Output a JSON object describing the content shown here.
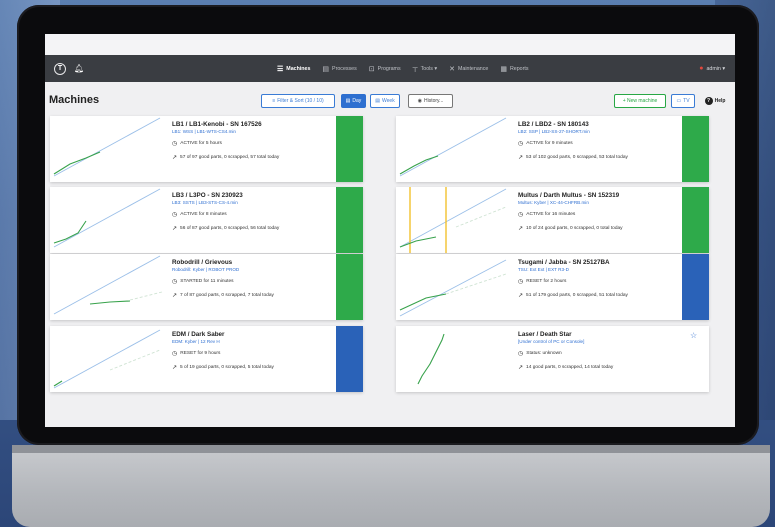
{
  "colors": {
    "green": "#2eaa4a",
    "blue": "#2a62b8",
    "accent": "#2f6fd1",
    "navbar": "#3a3d42"
  },
  "navbar": {
    "logo": "T",
    "items": [
      {
        "label": "Machines",
        "icon": "machines-icon",
        "glyph": "☰"
      },
      {
        "label": "Processes",
        "icon": "processes-icon",
        "glyph": "▤"
      },
      {
        "label": "Programs",
        "icon": "programs-icon",
        "glyph": "⊡"
      },
      {
        "label": "Tools ▾",
        "icon": "tools-icon",
        "glyph": "┬"
      },
      {
        "label": "Maintenance",
        "icon": "maintenance-icon",
        "glyph": "✕"
      },
      {
        "label": "Reports",
        "icon": "reports-icon",
        "glyph": "▦"
      }
    ],
    "user": "admin ▾"
  },
  "toolbar": {
    "title": "Machines",
    "filter": "Filter & Sort (10 / 10)",
    "day": "Day",
    "week": "Week",
    "history": "History...",
    "new_machine": "+ New machine",
    "tv": "TV",
    "help": "Help"
  },
  "machines": [
    {
      "title": "LB1 / LB1-Kenobi - SN 167526",
      "program": "LB1: WSS | LB1-WTS-CS4.min",
      "status": "ACTIVE for 5 hours",
      "parts": "57 of 97 good parts, 0 scrapped, 57 total today",
      "status_color": "green",
      "favorite": true
    },
    {
      "title": "LB2 / LBD2 - SN 180143",
      "program": "LB2: SSP | LB2-SS-27-SHORT.min",
      "status": "ACTIVE for 9 minutes",
      "parts": "53 of 102 good parts, 0 scrapped, 53 total today",
      "status_color": "green",
      "favorite": true
    },
    {
      "title": "LB3 / L3PO - SN 230923",
      "program": "LB3: SSTS | LB3-STS-CS-4.min",
      "status": "ACTIVE for 8 minutes",
      "parts": "56 of 87 good parts, 0 scrapped, 56 total today",
      "status_color": "green",
      "favorite": true
    },
    {
      "title": "Multus / Darth Multus - SN 152319",
      "program": "Multus: Kyber | XC-44-CHFRB.min",
      "status": "ACTIVE for 16 minutes",
      "parts": "10 of 24 good parts, 0 scrapped, 0 total today",
      "status_color": "green",
      "favorite": false
    },
    {
      "title": "Robodrill / Grievous",
      "program": "Robodrill: Kyber | ROBOT PROD",
      "status": "STARTED for 11 minutes",
      "parts": "7 of 87 good parts, 0 scrapped, 7 total today",
      "status_color": "green",
      "favorite": false
    },
    {
      "title": "Tsugami / Jabba - SN 25127BA",
      "program": "TSU: Ext Ext | EXT R3-D",
      "status": "RESET for 2 hours",
      "parts": "51 of 179 good parts, 0 scrapped, 51 total today",
      "status_color": "blue",
      "favorite": false
    },
    {
      "title": "EDM / Dark Saber",
      "program": "EDM: Kyber | 12 Rev H",
      "status": "RESET for 9 hours",
      "parts": "5 of 19 good parts, 0 scrapped, 5 total today",
      "status_color": "blue",
      "favorite": false
    },
    {
      "title": "Laser / Death Star",
      "program": "[Under control of PC or Console]",
      "status": "Status: unknown",
      "parts": "14 good parts, 0 scrapped, 14 total today",
      "status_color": "none",
      "favorite": false
    }
  ]
}
